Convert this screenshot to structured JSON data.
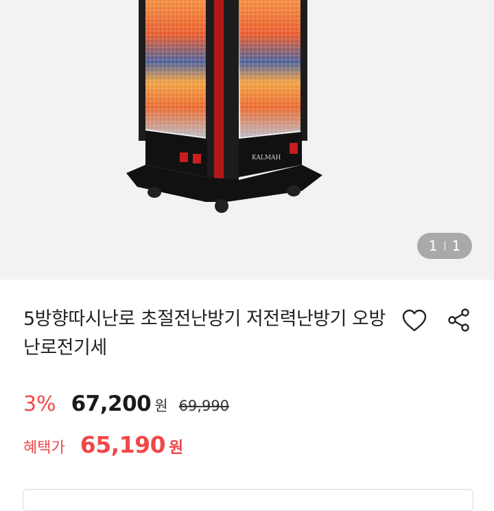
{
  "product": {
    "image_name": "product-image-heater",
    "brand_text": "KALMAH",
    "image_counter": {
      "current": "1",
      "total": "1"
    },
    "title": "5방향따시난로 초절전난방기 저전력난방기 오방난로전기세",
    "discount": "3%",
    "price": "67,200",
    "price_unit": "원",
    "original_price": "69,990",
    "benefit_label": "혜택가",
    "benefit_price": "65,190",
    "benefit_unit": "원"
  },
  "icons": {
    "like": "heart-icon",
    "share": "share-icon"
  },
  "colors": {
    "accent": "#f04848",
    "text": "#222222"
  }
}
